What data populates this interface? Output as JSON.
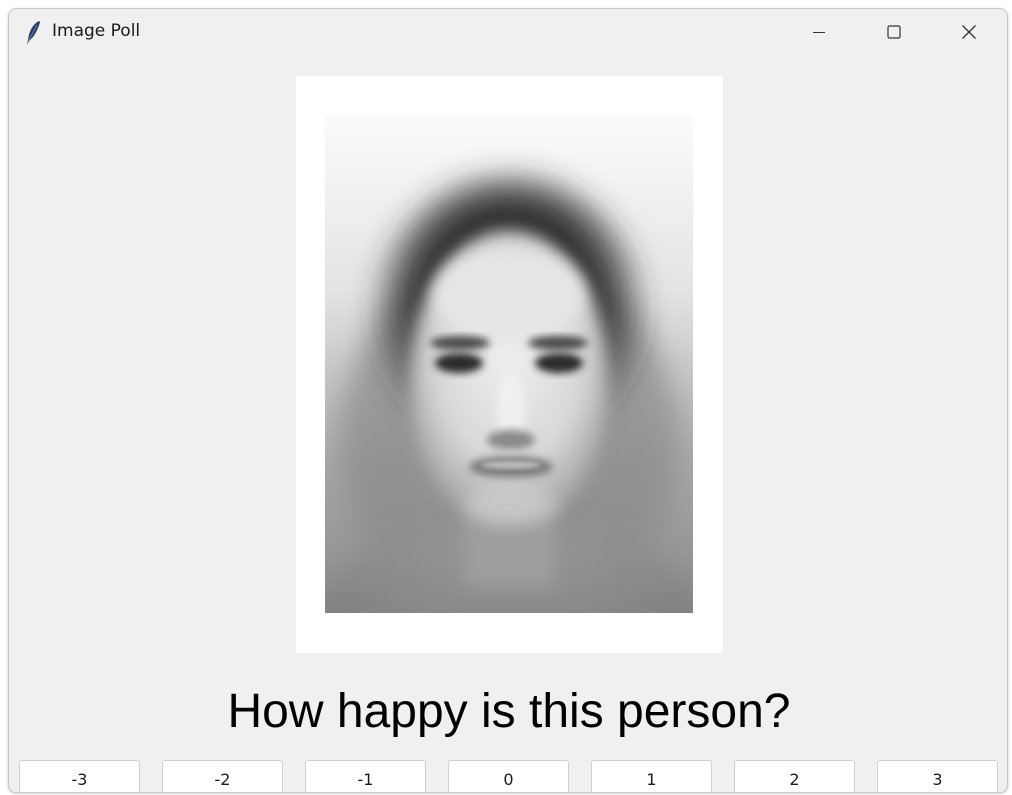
{
  "window": {
    "title": "Image Poll",
    "icon": "feather-icon",
    "controls": [
      "minimize-icon",
      "maximize-icon",
      "close-icon"
    ]
  },
  "poll": {
    "image": "averaged-face-photo",
    "question": "How happy is this person?",
    "options": [
      "-3",
      "-2",
      "-1",
      "0",
      "1",
      "2",
      "3"
    ]
  }
}
